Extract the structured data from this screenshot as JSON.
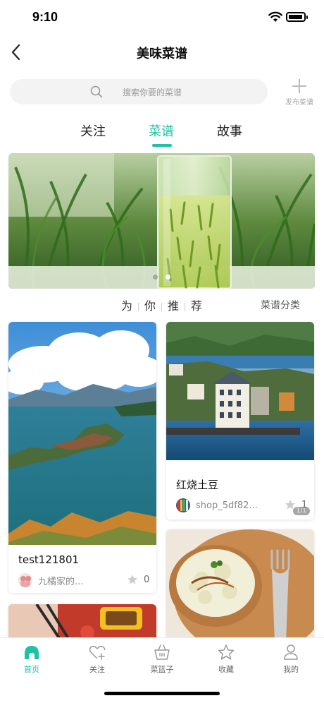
{
  "status_bar": {
    "time": "9:10"
  },
  "header": {
    "title": "美味菜谱"
  },
  "search": {
    "placeholder": "搜索你要的菜谱",
    "publish_label": "发布菜谱"
  },
  "tabs": [
    {
      "label": "关注",
      "active": false
    },
    {
      "label": "菜谱",
      "active": true
    },
    {
      "label": "故事",
      "active": false
    }
  ],
  "banner": {
    "slide_count": 2,
    "active_slide": 2
  },
  "recommend": {
    "chars": [
      "为",
      "你",
      "推",
      "荐"
    ],
    "category_link": "菜谱分类"
  },
  "feed": {
    "left": [
      {
        "title": "test121801",
        "author": "九橘家的...",
        "likes": "0"
      }
    ],
    "right": [
      {
        "title": "红烧土豆",
        "author": "shop_5df82...",
        "likes": "1",
        "pager": "1/1"
      }
    ]
  },
  "tabbar": [
    {
      "label": "首页",
      "icon": "home-icon",
      "active": true
    },
    {
      "label": "关注",
      "icon": "heart-plus-icon",
      "active": false
    },
    {
      "label": "菜篮子",
      "icon": "basket-icon",
      "active": false
    },
    {
      "label": "收藏",
      "icon": "star-icon",
      "active": false
    },
    {
      "label": "我的",
      "icon": "user-icon",
      "active": false
    }
  ],
  "colors": {
    "accent": "#1ec2a6",
    "text": "#222222",
    "muted": "#9a9a9a"
  }
}
